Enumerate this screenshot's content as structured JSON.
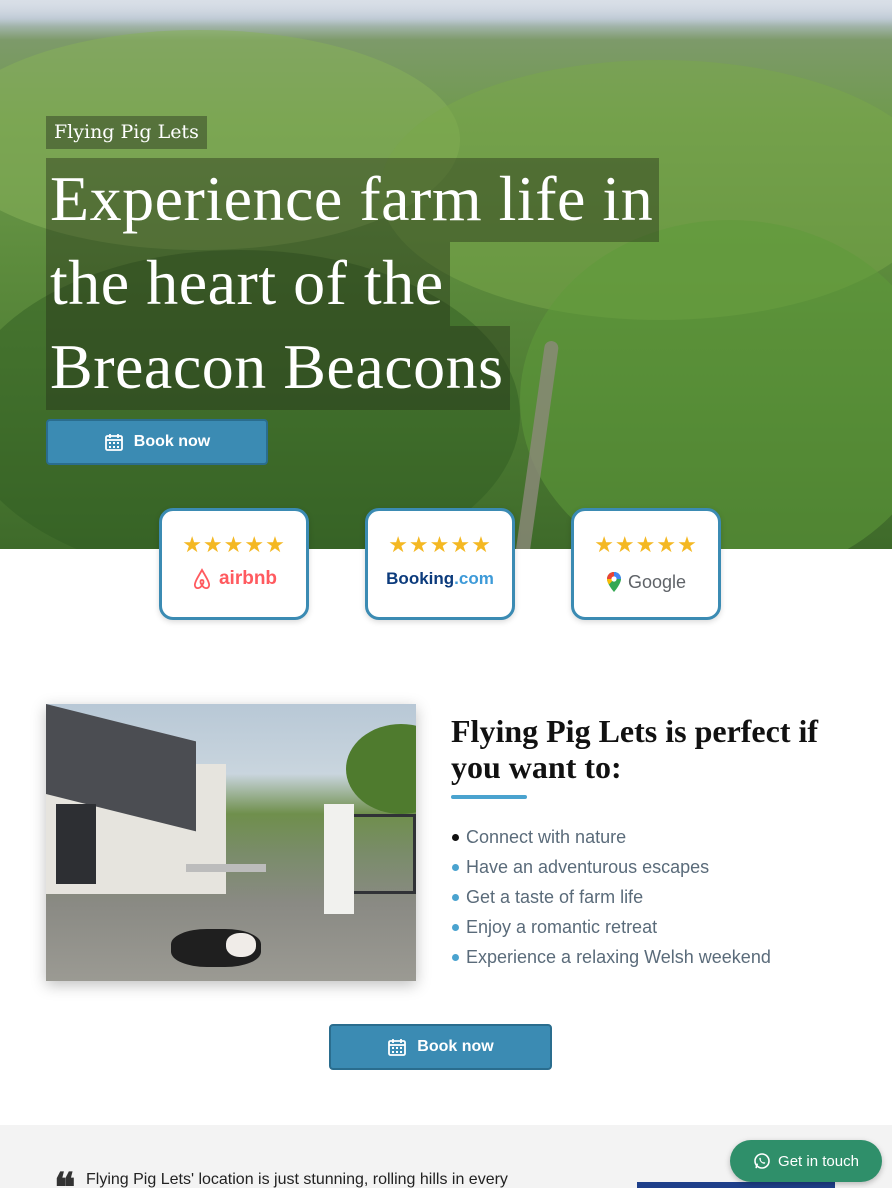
{
  "hero": {
    "brand": "Flying Pig Lets",
    "headline_lines": [
      "Experience farm life in",
      "the heart of the",
      "Breacon Beacons"
    ],
    "book_label": "Book now"
  },
  "reviews": [
    {
      "platform": "airbnb",
      "stars": "★★★★★",
      "rating": 5
    },
    {
      "platform": "Booking",
      "platform_suffix": ".com",
      "stars": "★★★★★",
      "rating": 4.8
    },
    {
      "platform": "Google",
      "stars": "★★★★★",
      "rating": 5
    }
  ],
  "perfect": {
    "title": "Flying Pig Lets is perfect if you want to:",
    "items": [
      "Connect with nature",
      "Have an adventurous escapes",
      "Get a taste of farm life",
      "Enjoy a romantic retreat",
      "Experience a relaxing Welsh weekend"
    ],
    "book_label": "Book now"
  },
  "testimonial": {
    "quote_mark": "❝",
    "text": "Flying Pig Lets' location is just stunning, rolling hills in every"
  },
  "chat": {
    "label": "Get in touch"
  },
  "colors": {
    "accent": "#3b8bb3",
    "accent_light": "#4aa3cf",
    "star": "#f4b823",
    "airbnb": "#ff5a5f",
    "booking": "#0c3b7c",
    "whatsapp": "#2f8f6a"
  }
}
